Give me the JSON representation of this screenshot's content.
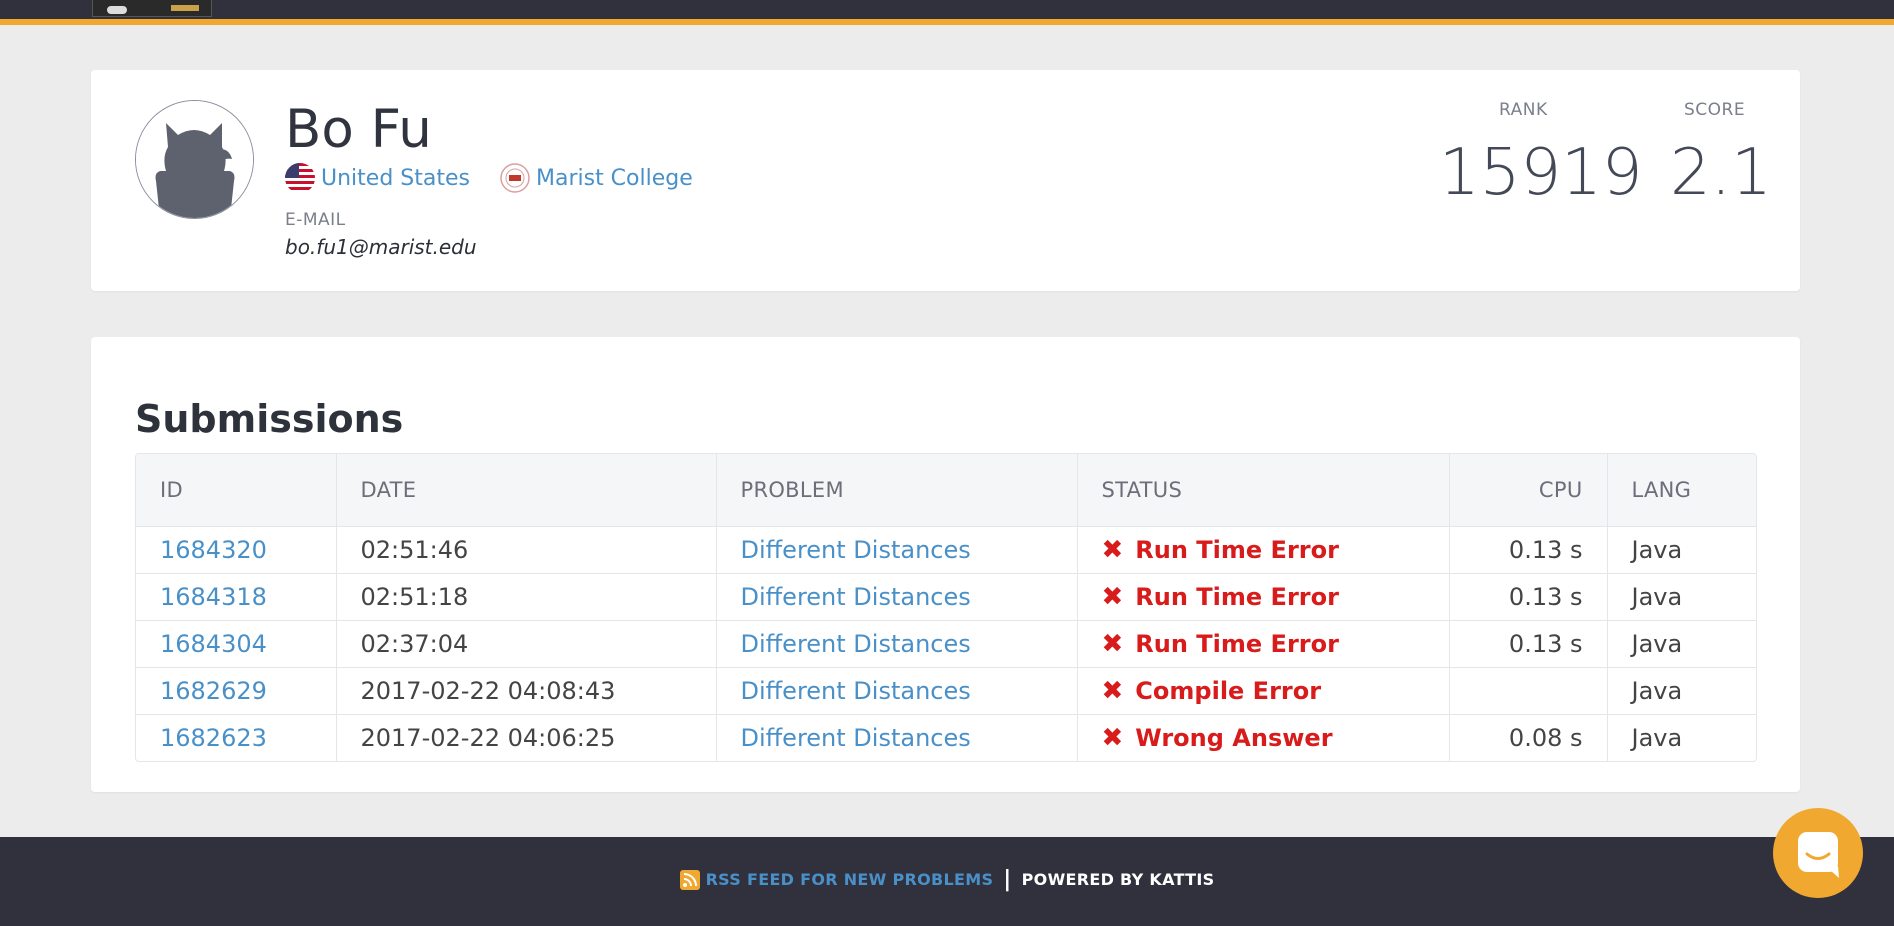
{
  "colors": {
    "topbar": "#30313d",
    "accent": "#f0a830",
    "link": "#4a90c8",
    "error": "#d81b1b",
    "footer": "#30313d"
  },
  "profile": {
    "name": "Bo Fu",
    "country": "United States",
    "country_icon": "us-flag-icon",
    "school": "Marist College",
    "school_icon": "college-seal-icon",
    "email_label": "E-MAIL",
    "email": "bo.fu1@marist.edu",
    "rank_label": "RANK",
    "rank": "15919",
    "score_label": "SCORE",
    "score": "2.1"
  },
  "submissions": {
    "title": "Submissions",
    "columns": [
      "ID",
      "DATE",
      "PROBLEM",
      "STATUS",
      "CPU",
      "LANG"
    ],
    "rows": [
      {
        "id": "1684320",
        "date": "02:51:46",
        "problem": "Different Distances",
        "status": "Run Time Error",
        "cpu": "0.13 s",
        "lang": "Java"
      },
      {
        "id": "1684318",
        "date": "02:51:18",
        "problem": "Different Distances",
        "status": "Run Time Error",
        "cpu": "0.13 s",
        "lang": "Java"
      },
      {
        "id": "1684304",
        "date": "02:37:04",
        "problem": "Different Distances",
        "status": "Run Time Error",
        "cpu": "0.13 s",
        "lang": "Java"
      },
      {
        "id": "1682629",
        "date": "2017-02-22 04:08:43",
        "problem": "Different Distances",
        "status": "Compile Error",
        "cpu": "",
        "lang": "Java"
      },
      {
        "id": "1682623",
        "date": "2017-02-22 04:06:25",
        "problem": "Different Distances",
        "status": "Wrong Answer",
        "cpu": "0.08 s",
        "lang": "Java"
      }
    ]
  },
  "footer": {
    "rss_icon": "rss-icon",
    "rss_text": "RSS FEED FOR NEW PROBLEMS",
    "separator": "|",
    "powered": "POWERED BY KATTIS"
  },
  "chat": {
    "icon": "chat-icon"
  }
}
